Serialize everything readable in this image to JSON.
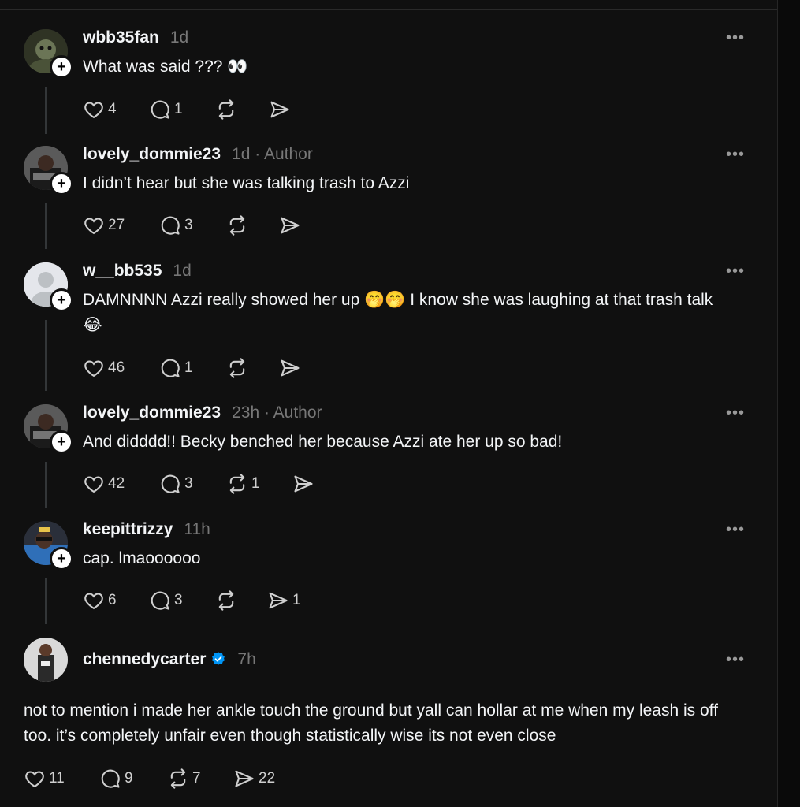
{
  "posts": [
    {
      "username": "wbb35fan",
      "time": "1d",
      "author_tag": "",
      "text": "What was said ??? 👀",
      "likes": "4",
      "replies": "1",
      "reposts": "",
      "shares": ""
    },
    {
      "username": "lovely_dommie23",
      "time": "1d",
      "author_tag": "· Author",
      "text": "I didn’t hear but she was talking trash to Azzi",
      "likes": "27",
      "replies": "3",
      "reposts": "",
      "shares": ""
    },
    {
      "username": "w__bb535",
      "time": "1d",
      "author_tag": "",
      "text": "DAMNNNN Azzi really showed her up 🤭🤭 I know she was laughing at that trash talk 😂",
      "likes": "46",
      "replies": "1",
      "reposts": "",
      "shares": ""
    },
    {
      "username": "lovely_dommie23",
      "time": "23h",
      "author_tag": "· Author",
      "text": "And didddd!! Becky benched her because Azzi ate her up so bad!",
      "likes": "42",
      "replies": "3",
      "reposts": "1",
      "shares": ""
    },
    {
      "username": "keepittrizzy",
      "time": "11h",
      "author_tag": "",
      "text": "cap. lmaoooooo",
      "likes": "6",
      "replies": "3",
      "reposts": "",
      "shares": "1"
    },
    {
      "username": "chennedycarter",
      "time": "7h",
      "author_tag": "",
      "text": "not to mention i made her ankle touch the ground but yall can hollar at me when my leash is off too. it’s completely unfair even though statistically wise its not even close",
      "likes": "11",
      "replies": "9",
      "reposts": "7",
      "shares": "22"
    }
  ],
  "more_glyph": "•••",
  "follow_glyph": "+",
  "colors": {
    "background": "#101010",
    "text": "#f3f5f7",
    "muted": "#777777",
    "verified": "#0095f6"
  }
}
